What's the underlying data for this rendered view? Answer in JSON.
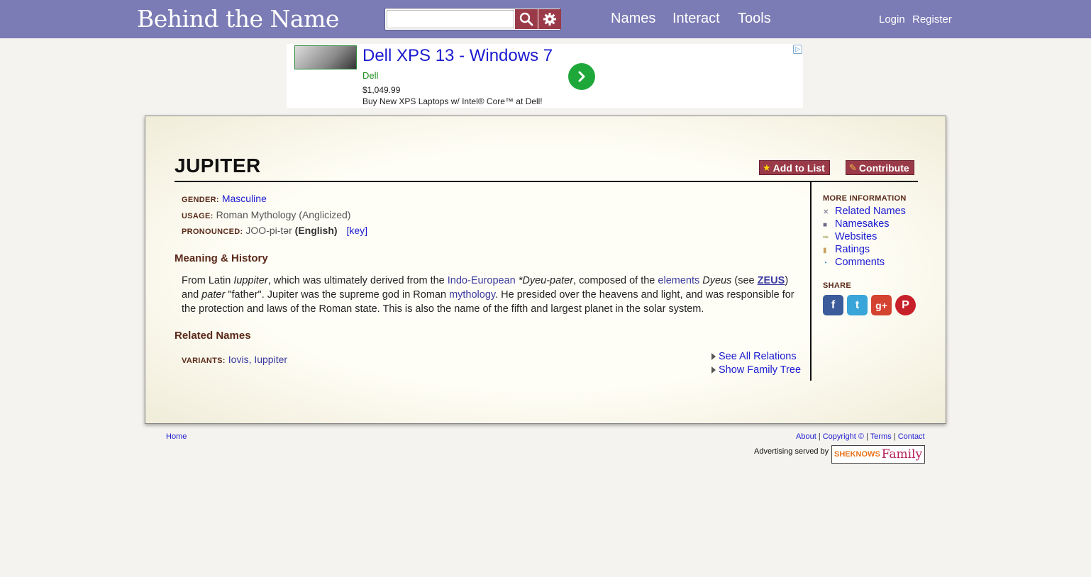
{
  "header": {
    "logo_text": "Behind the Name",
    "search_placeholder": "",
    "nav": [
      "Names",
      "Interact",
      "Tools"
    ],
    "login": "Login",
    "register": "Register"
  },
  "ad": {
    "title": "Dell XPS 13 - Windows 7",
    "brand": "Dell",
    "price": "$1,049.99",
    "description": "Buy New XPS Laptops w/ Intel® Core™ at Dell!"
  },
  "name": {
    "title": "JUPITER",
    "add_to_list": "Add to List",
    "contribute": "Contribute",
    "gender_label": "GENDER:",
    "gender": "Masculine",
    "usage_label": "USAGE:",
    "usage": "Roman Mythology (Anglicized)",
    "pronounced_label": "PRONOUNCED:",
    "pronounced": "JOO-pi-tər",
    "pronounced_lang": "(English)",
    "key": "[key]"
  },
  "meaning": {
    "heading": "Meaning & History",
    "t1": "From Latin ",
    "i1": "Iuppiter",
    "t2": ", which was ultimately derived from the ",
    "r1": "Indo-European",
    "t3": " ",
    "i2": "*Dyeu-pater",
    "t4": ", composed of the ",
    "r2": "elements",
    "t5": " ",
    "i3": "Dyeus",
    "t6": " (see ",
    "r3": "ZEUS",
    "t7": ") and ",
    "i4": "pater",
    "t8": " \"father\". Jupiter was the supreme god in Roman ",
    "r4": "mythology",
    "t9": ". He presided over the heavens and light, and was responsible for the protection and laws of the Roman state. This is also the name of the fifth and largest planet in the solar system."
  },
  "related": {
    "heading": "Related Names",
    "variants_label": "VARIANTS:",
    "variants": "Iovis, Iuppiter",
    "see_all": "See All Relations",
    "family_tree": "Show Family Tree"
  },
  "sidebar": {
    "more_info_label": "MORE INFORMATION",
    "links": [
      "Related Names",
      "Namesakes",
      "Websites",
      "Ratings",
      "Comments"
    ],
    "share_label": "SHARE",
    "share": [
      {
        "name": "facebook",
        "glyph": "f",
        "color": "#3b5b9a"
      },
      {
        "name": "twitter",
        "glyph": "t",
        "color": "#3aa5d8"
      },
      {
        "name": "googleplus",
        "glyph": "g+",
        "color": "#d4432f"
      },
      {
        "name": "pinterest",
        "glyph": "P",
        "color": "#c8202a"
      }
    ]
  },
  "footer": {
    "home": "Home",
    "about": "About",
    "copyright": "Copyright ©",
    "terms": "Terms",
    "contact": "Contact",
    "sep": "|",
    "ad_served": "Advertising served by",
    "sheknows_1": "SHEKNOWS",
    "sheknows_2": "Family"
  }
}
